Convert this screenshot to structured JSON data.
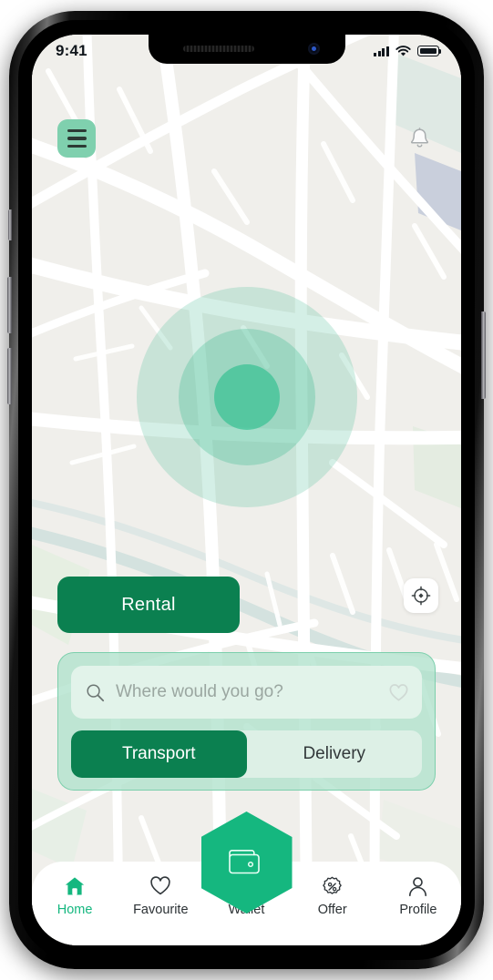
{
  "status_bar": {
    "time": "9:41",
    "signal_icon": "cellular-signal-icon",
    "wifi_icon": "wifi-icon",
    "battery_icon": "battery-full-icon"
  },
  "header": {
    "menu_icon": "hamburger-menu-icon",
    "notification_icon": "bell-icon"
  },
  "map": {
    "background_color": "#f0efeb",
    "road_color": "#ffffff",
    "water_color": "#cfdfdd",
    "park_color": "#e6efe2",
    "pin_icon": "location-pin-icon",
    "radar_color": "#3cbe8e"
  },
  "rental": {
    "label": "Rental",
    "color": "#0b8050"
  },
  "locate": {
    "icon": "crosshair-target-icon"
  },
  "search": {
    "placeholder": "Where would you go?",
    "search_icon": "magnifier-icon",
    "favourite_icon": "heart-outline-icon",
    "panel_color": "#b0e2cc"
  },
  "segmented": {
    "options": [
      {
        "label": "Transport",
        "active": true
      },
      {
        "label": "Delivery",
        "active": false
      }
    ],
    "active_color": "#0b8050"
  },
  "wallet_fab": {
    "icon": "wallet-icon",
    "color": "#15b77f"
  },
  "bottom_nav": {
    "active_color": "#15b77f",
    "items": [
      {
        "label": "Home",
        "icon": "home-icon",
        "active": true
      },
      {
        "label": "Favourite",
        "icon": "heart-outline-icon",
        "active": false
      },
      {
        "label": "Wallet",
        "icon": "wallet-icon",
        "active": false
      },
      {
        "label": "Offer",
        "icon": "percent-badge-icon",
        "active": false
      },
      {
        "label": "Profile",
        "icon": "user-icon",
        "active": false
      }
    ]
  }
}
